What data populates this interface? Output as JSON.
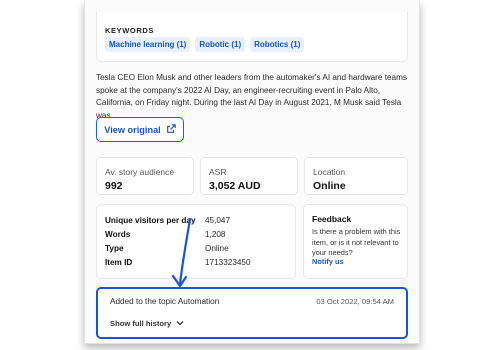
{
  "keywords": {
    "title": "KEYWORDS",
    "tags": [
      "Machine learning (1)",
      "Robotic (1)",
      "Robotics (1)"
    ]
  },
  "excerpt": "Tesla CEO Elon Musk and other leaders from the automaker's AI and hardware teams spoke at the company's 2022 AI Day, an engineer-recruiting event in Palo Alto, California, on Friday night. During the last AI Day in August 2021, M Musk said Tesla was...",
  "view_original": {
    "label": "View original",
    "icon": "external-link-icon"
  },
  "stats": [
    {
      "label": "Av. story audience",
      "value": "992"
    },
    {
      "label": "ASR",
      "value": "3,052 AUD"
    },
    {
      "label": "Location",
      "value": "Online"
    }
  ],
  "details": [
    {
      "key": "Unique visitors per day",
      "value": "45,047"
    },
    {
      "key": "Words",
      "value": "1,208"
    },
    {
      "key": "Type",
      "value": "Online"
    },
    {
      "key": "Item ID",
      "value": "1713323450"
    }
  ],
  "feedback": {
    "title": "Feedback",
    "text": "Is there a problem with this item, or is it not relevant to your needs?",
    "link": "Notify us"
  },
  "history": {
    "text": "Added to the topic Automation",
    "date": "03 Oct 2022, 09:54 AM",
    "toggle": "Show full history"
  },
  "colors": {
    "accent": "#1a56c9",
    "tag_bg": "#e7f0fc",
    "annotation": "#1a56c9"
  }
}
